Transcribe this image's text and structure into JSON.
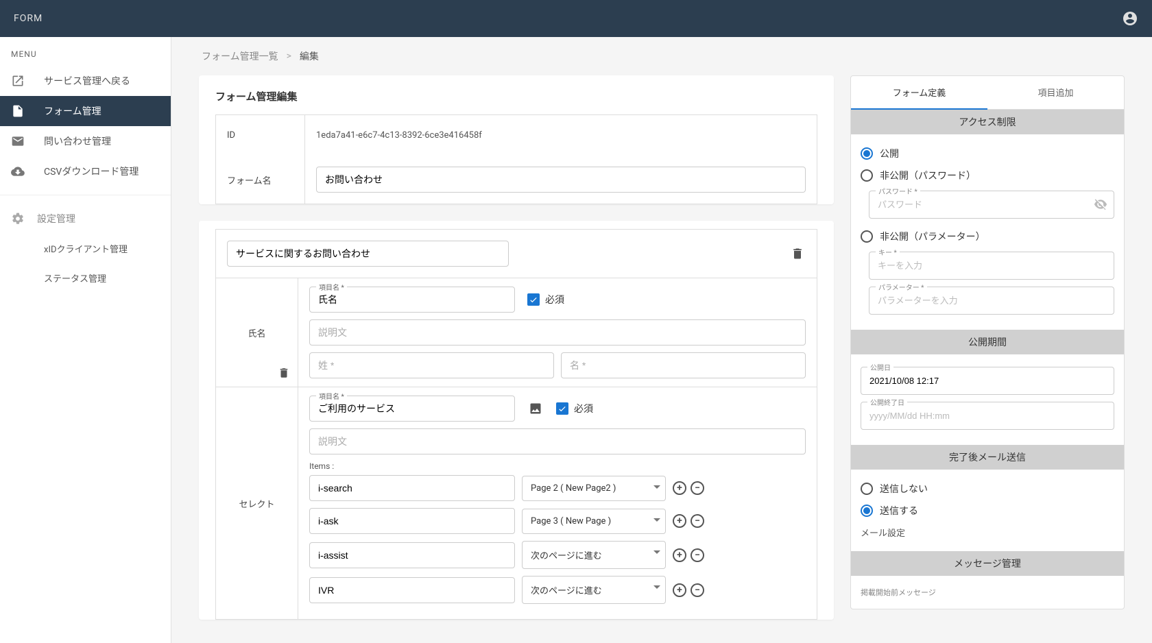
{
  "header": {
    "title": "FORM"
  },
  "sidebar": {
    "menu_label": "MENU",
    "items": [
      {
        "label": "サービス管理へ戻る"
      },
      {
        "label": "フォーム管理"
      },
      {
        "label": "問い合わせ管理"
      },
      {
        "label": "CSVダウンロード管理"
      }
    ],
    "settings_label": "設定管理",
    "settings_items": [
      {
        "label": "xIDクライアント管理"
      },
      {
        "label": "ステータス管理"
      }
    ]
  },
  "breadcrumb": {
    "parent": "フォーム管理一覧",
    "separator": ">",
    "current": "編集"
  },
  "page": {
    "title": "フォーム管理編集",
    "id_label": "ID",
    "id_value": "1eda7a41-e6c7-4c13-8392-6ce3e416458f",
    "name_label": "フォーム名",
    "name_value": "お問い合わせ"
  },
  "builder": {
    "page_name": "サービスに関するお問い合わせ",
    "field_name_label": "項目名 *",
    "required_label": "必須",
    "desc_placeholder": "説明文",
    "items_label": "Items :",
    "fields": [
      {
        "type_label": "氏名",
        "name_value": "氏名",
        "sei_placeholder": "姓 *",
        "mei_placeholder": "名 *"
      },
      {
        "type_label": "セレクト",
        "name_value": "ご利用のサービス",
        "options": [
          {
            "text": "i-search",
            "select": "Page 2 ( New Page2 )"
          },
          {
            "text": "i-ask",
            "select": "Page 3 ( New Page )"
          },
          {
            "text": "i-assist",
            "select": "次のページに進む"
          },
          {
            "text": "IVR",
            "select": "次のページに進む"
          }
        ]
      }
    ]
  },
  "right_panel": {
    "tabs": {
      "definition": "フォーム定義",
      "add_item": "項目追加"
    },
    "access": {
      "header": "アクセス制限",
      "public": "公開",
      "private_pw": "非公開（パスワード）",
      "pw_label": "パスワード *",
      "pw_placeholder": "パスワード",
      "private_param": "非公開（パラメーター）",
      "key_label": "キー *",
      "key_placeholder": "キーを入力",
      "param_label": "パラメーター *",
      "param_placeholder": "パラメーターを入力"
    },
    "period": {
      "header": "公開期間",
      "start_label": "公開日",
      "start_value": "2021/10/08 12:17",
      "end_label": "公開終了日",
      "end_placeholder": "yyyy/MM/dd HH:mm"
    },
    "mail": {
      "header": "完了後メール送信",
      "dont_send": "送信しない",
      "send": "送信する",
      "settings": "メール設定"
    },
    "message": {
      "header": "メッセージ管理",
      "pre_label": "掲載開始前メッセージ"
    }
  }
}
